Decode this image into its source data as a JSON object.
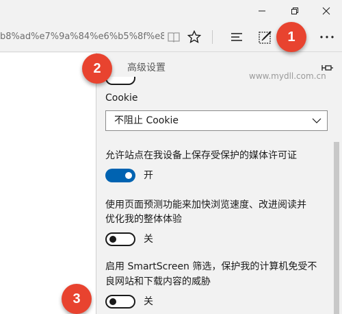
{
  "window": {
    "controls": {
      "minimize": "minimize-icon",
      "restore": "restore-icon",
      "close": "close-icon"
    }
  },
  "toolbar": {
    "url": "b8%ad%e7%9a%84%e6%b5%8f%e8%a",
    "icons": [
      "reading-view-icon",
      "favorite-star-icon",
      "hub-icon",
      "web-note-icon",
      "more-icon"
    ]
  },
  "panel": {
    "title": "高级设置",
    "watermark": "www.mydll.com.cn",
    "cookie": {
      "label": "Cookie",
      "selected": "不阻止 Cookie"
    },
    "media_license": {
      "label": "允许站点在我设备上保存受保护的媒体许可证",
      "state_label": "开",
      "on": true
    },
    "page_prediction": {
      "label_line1": "使用页面预测功能来加快浏览速度、改进阅读并",
      "label_line2": "优化我的整体体验",
      "state_label": "关",
      "on": false
    },
    "smartscreen": {
      "label_line1": "启用 SmartScreen 筛选，保护我的计算机免受不",
      "label_line2": "良网站和下载内容的威胁",
      "state_label": "关",
      "on": false
    }
  },
  "badges": [
    "1",
    "2",
    "3"
  ],
  "colors": {
    "accent": "#0063b1",
    "badge": "#e8432f"
  }
}
